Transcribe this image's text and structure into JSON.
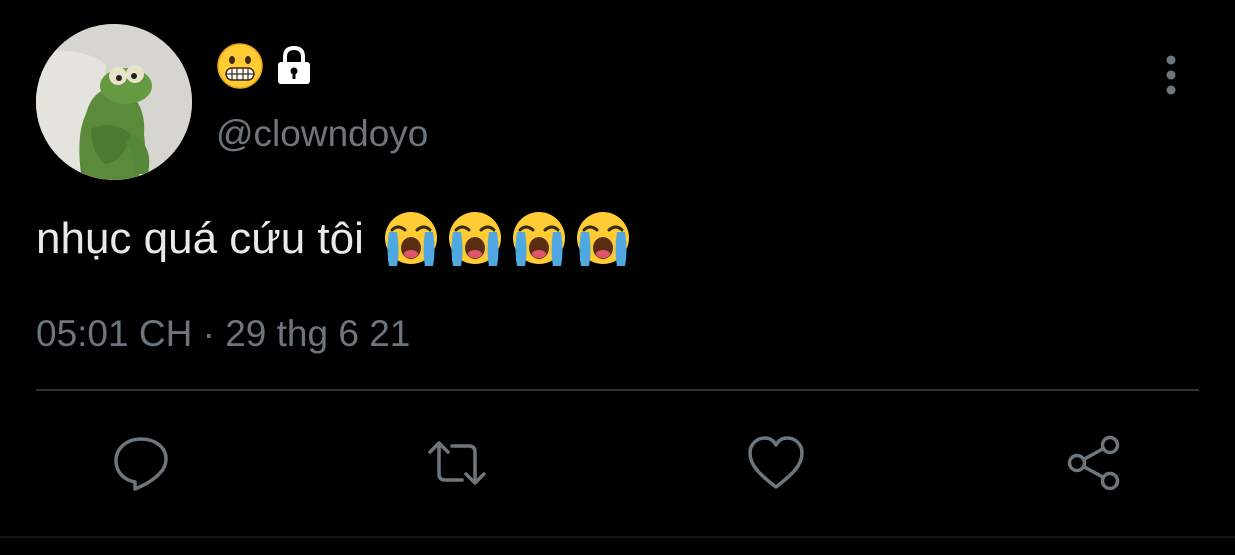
{
  "tweet": {
    "display_name_emoji": "grimacing-face",
    "account_lock_icon": "lock-icon",
    "handle": "@clowndoyo",
    "text": "nhục quá cứu tôi",
    "text_emojis": [
      "loudly-crying-face",
      "loudly-crying-face",
      "loudly-crying-face",
      "loudly-crying-face"
    ],
    "timestamp": "05:01 CH · 29 thg 6 21"
  },
  "actions": [
    {
      "name": "reply",
      "icon": "comment-bubble-icon"
    },
    {
      "name": "retweet",
      "icon": "retweet-icon"
    },
    {
      "name": "like",
      "icon": "heart-icon"
    },
    {
      "name": "share",
      "icon": "share-icon"
    }
  ],
  "colors": {
    "background": "#000000",
    "primary_text": "#e7e9ea",
    "secondary_text": "#6e767d",
    "divider": "#2f3336"
  }
}
